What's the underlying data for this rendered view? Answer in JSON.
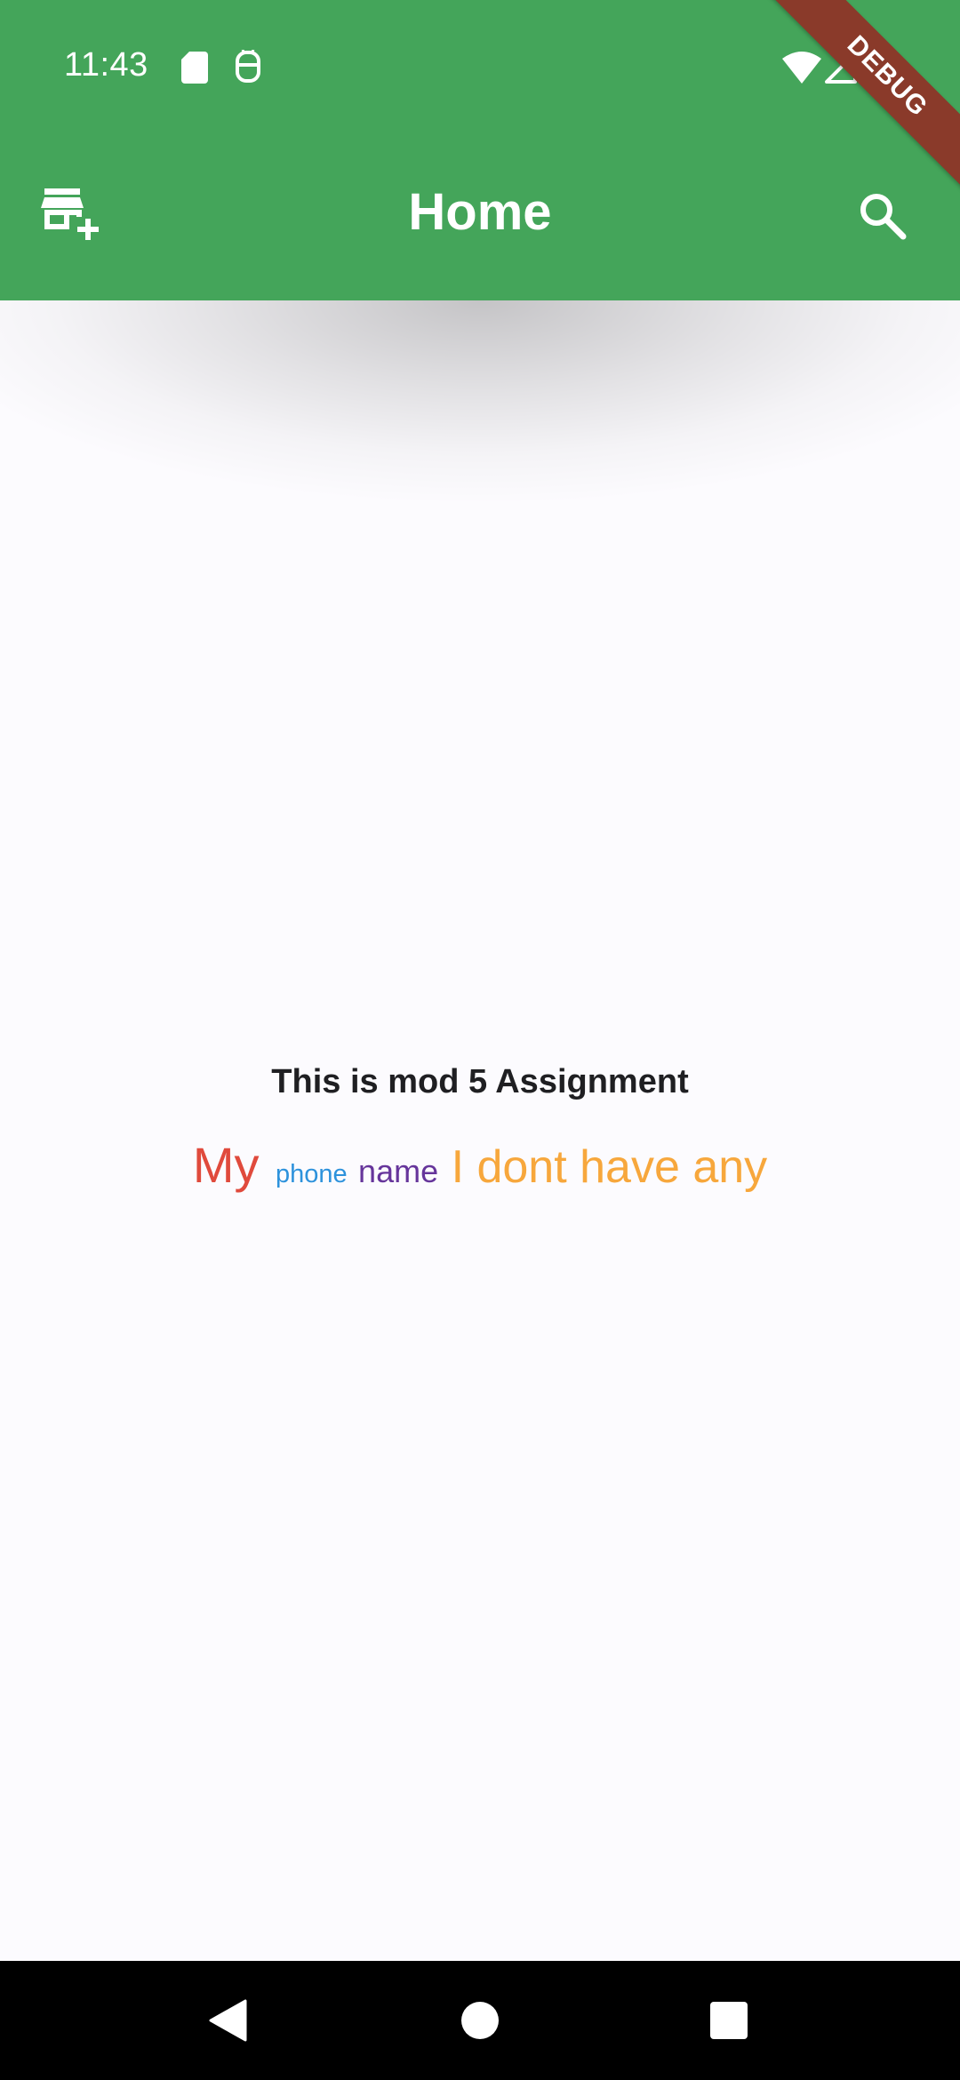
{
  "status_bar": {
    "time": "11:43",
    "icons": [
      "sd-card-icon",
      "notification-app-icon",
      "wifi-icon",
      "cellular-signal-icon",
      "battery-icon"
    ]
  },
  "debug_banner": {
    "label": "DEBUG"
  },
  "app_bar": {
    "title": "Home",
    "leading_icon": "add-business-icon",
    "trailing_icon": "search-icon"
  },
  "main": {
    "heading": "This is mod 5 Assignment",
    "rich_text": {
      "segments": [
        {
          "text": "My",
          "color": "#e04a3c"
        },
        {
          "text": "phone",
          "color": "#2d92dc"
        },
        {
          "text": "name",
          "color": "#66359b"
        },
        {
          "text": "I dont have any",
          "color": "#f7a73c"
        }
      ]
    }
  },
  "nav_bar": {
    "buttons": [
      "back-icon",
      "home-icon",
      "recents-icon"
    ]
  },
  "colors": {
    "primary": "#44a55a",
    "background": "#fcfbfe",
    "debug_banner": "#8a3a2a"
  }
}
